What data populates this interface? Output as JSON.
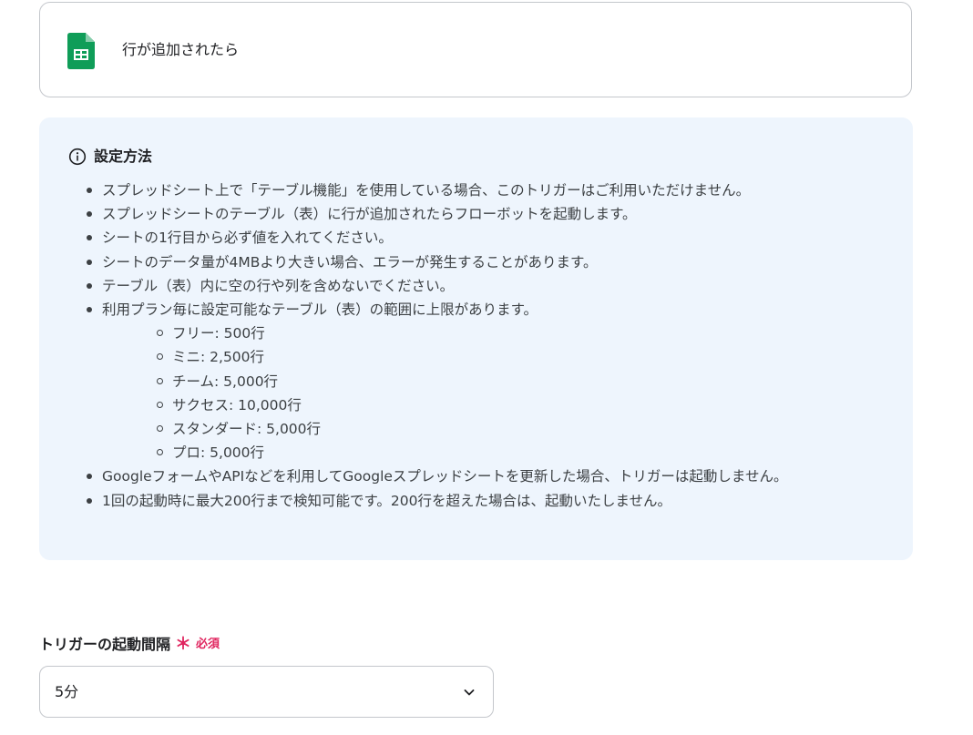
{
  "trigger": {
    "title": "行が追加されたら",
    "icon": "google-sheets-icon",
    "icon_color": "#0f9d58"
  },
  "info": {
    "icon": "info-icon",
    "title": "設定方法",
    "background": "#eef5fd",
    "notes": [
      "スプレッドシート上で「テーブル機能」を使用している場合、このトリガーはご利用いただけません。",
      "スプレッドシートのテーブル（表）に行が追加されたらフローボットを起動します。",
      "シートの1行目から必ず値を入れてください。",
      "シートのデータ量が4MBより大きい場合、エラーが発生することがあります。",
      "テーブル（表）内に空の行や列を含めないでください。",
      "利用プラン毎に設定可能なテーブル（表）の範囲に上限があります。"
    ],
    "plan_limits": [
      "フリー: 500行",
      "ミニ: 2,500行",
      "チーム: 5,000行",
      "サクセス: 10,000行",
      "スタンダード: 5,000行",
      "プロ: 5,000行"
    ],
    "notes_after": [
      "GoogleフォームやAPIなどを利用してGoogleスプレッドシートを更新した場合、トリガーは起動しません。",
      "1回の起動時に最大200行まで検知可能です。200行を超えた場合は、起動いたしません。"
    ]
  },
  "interval": {
    "label": "トリガーの起動間隔",
    "required_mark": "＊",
    "required_label": "必須",
    "required_color": "#e0245e",
    "value": "5分",
    "icon": "chevron-down-icon"
  }
}
